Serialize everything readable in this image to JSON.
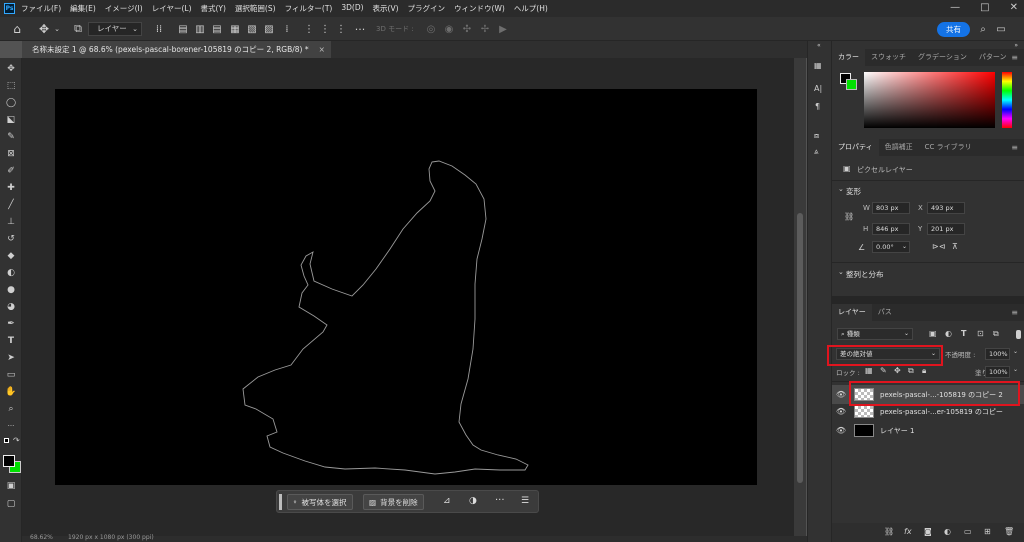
{
  "app": {
    "logo": "Ps"
  },
  "menu": [
    "ファイル(F)",
    "編集(E)",
    "イメージ(I)",
    "レイヤー(L)",
    "書式(Y)",
    "選択範囲(S)",
    "フィルター(T)",
    "3D(D)",
    "表示(V)",
    "プラグイン",
    "ウィンドウ(W)",
    "ヘルプ(H)"
  ],
  "window_controls": {
    "minimize": "—",
    "maximize": "□",
    "close": "✕"
  },
  "options_bar": {
    "layer_select": "レイヤー",
    "mode_3d": "3D モード :",
    "share": "共有"
  },
  "document_tab": {
    "title": "名称未設定 1 @ 68.6% (pexels-pascal-borener-105819 のコピー 2, RGB/8) *",
    "close": "×"
  },
  "context_bar": {
    "select_subject": "被写体を選択",
    "remove_background": "背景を削除"
  },
  "status": {
    "zoom": "68.62%",
    "size": "1920 px x 1080 px (300 ppi)"
  },
  "colors": {
    "foreground": "#000000",
    "background": "#00e000",
    "highlight": "#e0141e",
    "accent": "#1473e6"
  },
  "color_panel": {
    "tabs": [
      "カラー",
      "スウォッチ",
      "グラデーション",
      "パターン"
    ]
  },
  "properties_panel": {
    "tabs": [
      "プロパティ",
      "色調補正",
      "CC ライブラリ"
    ],
    "kind": "ピクセルレイヤー",
    "transform_title": "変形",
    "w_label": "W",
    "w": "803 px",
    "h_label": "H",
    "h": "846 px",
    "x_label": "X",
    "x": "493 px",
    "y_label": "Y",
    "y": "201 px",
    "angle": "0.00°",
    "align_title": "整列と分布"
  },
  "layers_panel": {
    "tabs": [
      "レイヤー",
      "パス"
    ],
    "filter_kind": "種類",
    "blend_mode": "差の絶対値",
    "opacity_label": "不透明度 :",
    "opacity": "100%",
    "lock_label": "ロック :",
    "fill_label": "塗り :",
    "fill": "100%",
    "layers": [
      {
        "name": "pexels-pascal-...-105819 のコピー 2"
      },
      {
        "name": "pexels-pascal-...er-105819 のコピー"
      },
      {
        "name": "レイヤー 1"
      }
    ]
  }
}
